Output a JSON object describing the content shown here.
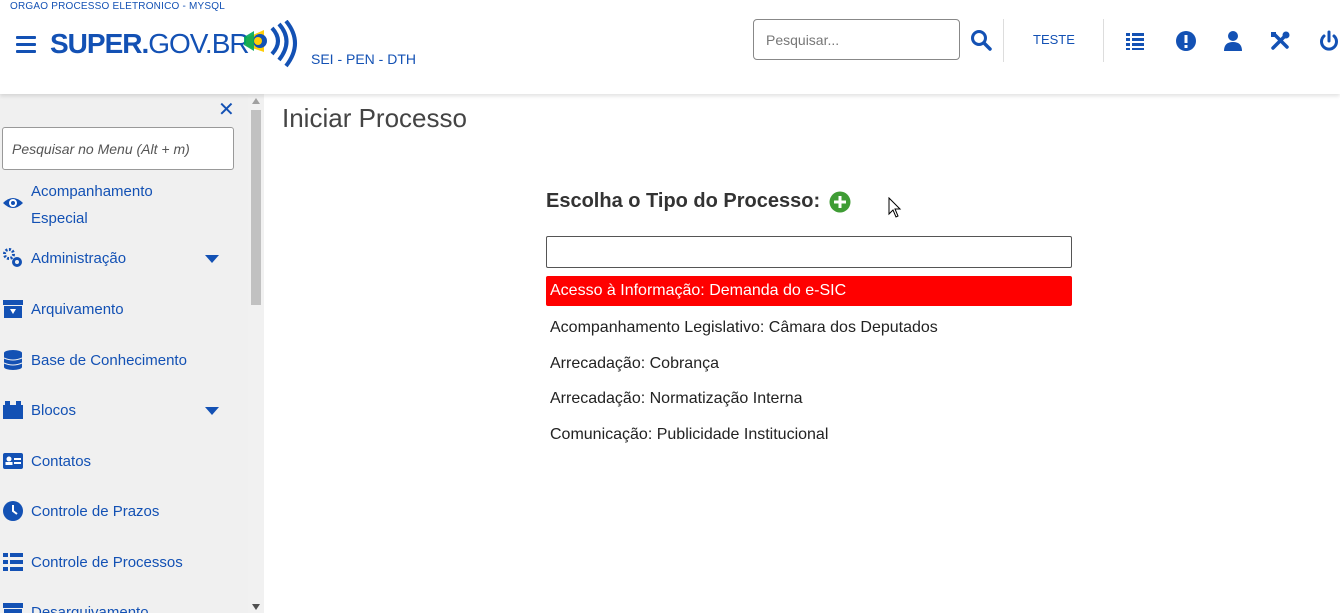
{
  "header": {
    "org_name": "ORGAO PROCESSO ELETRONICO - MYSQL",
    "logo_bold": "SUPER.",
    "logo_thin": "GOV.BR",
    "sistemas": "SEI - PEN - DTH",
    "search_placeholder": "Pesquisar...",
    "unidade": "TESTE",
    "icons": [
      "menu-icon",
      "search-icon",
      "blocks-icon",
      "notice-icon",
      "user-icon",
      "tools-icon",
      "power-icon"
    ],
    "accent_color": "#1351b4"
  },
  "sidebar": {
    "search_placeholder": "Pesquisar no Menu (Alt + m)",
    "items": [
      {
        "label_line1": "Acompanhamento",
        "label_line2": "Especial",
        "icon": "eye-icon"
      },
      {
        "label": "Administração",
        "icon": "gears-icon",
        "has_submenu": true
      },
      {
        "label": "Arquivamento",
        "icon": "archive-icon"
      },
      {
        "label": "Base de Conhecimento",
        "icon": "database-icon"
      },
      {
        "label": "Blocos",
        "icon": "blocks-icon",
        "has_submenu": true
      },
      {
        "label": "Contatos",
        "icon": "contact-card-icon"
      },
      {
        "label": "Controle de Prazos",
        "icon": "clock-icon"
      },
      {
        "label": "Controle de Processos",
        "icon": "list-icon"
      },
      {
        "label": "Desarquivamento",
        "icon": "unarchive-icon"
      }
    ]
  },
  "main": {
    "title": "Iniciar Processo",
    "choose_label": "Escolha o Tipo do Processo:",
    "filter_value": "",
    "tipos": [
      {
        "label": "Acesso à Informação: Demanda do e-SIC",
        "selected": true
      },
      {
        "label": "Acompanhamento Legislativo: Câmara dos Deputados",
        "selected": false
      },
      {
        "label": "Arrecadação: Cobrança",
        "selected": false
      },
      {
        "label": "Arrecadação: Normatização Interna",
        "selected": false
      },
      {
        "label": "Comunicação: Publicidade Institucional",
        "selected": false
      }
    ],
    "selected_color": "#ff0000",
    "add_button_color": "#3f9c35"
  }
}
